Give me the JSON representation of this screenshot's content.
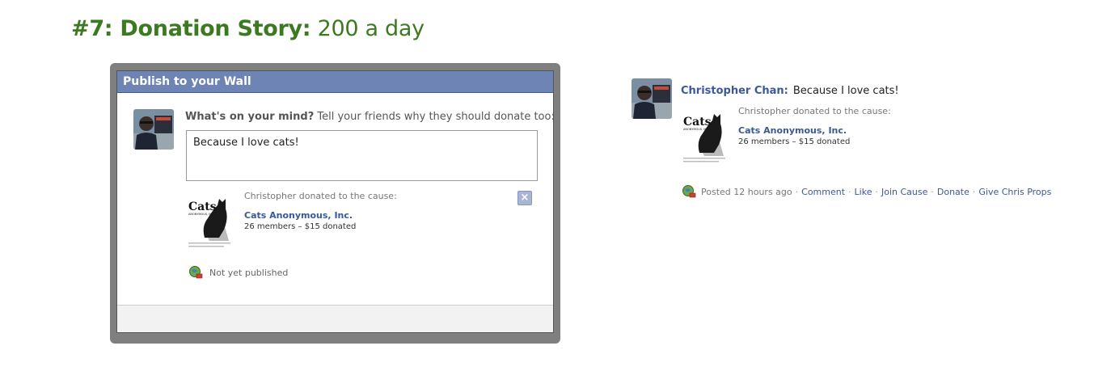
{
  "page": {
    "title_strong": "#7: Donation Story:",
    "title_rest": "200 a day"
  },
  "dialog": {
    "header": "Publish to your Wall",
    "prompt_bold": "What's on your mind?",
    "prompt_rest": "Tell your friends why they should donate too:",
    "message_value": "Because I love cats!",
    "close_label": "×",
    "status": "Not yet published"
  },
  "attachment": {
    "donated_line": "Christopher donated to the cause:",
    "cause_name": "Cats Anonymous, Inc.",
    "cause_stats": "26 members – $15 donated",
    "logo_text": "Cats",
    "logo_subtext": "ANONYMOUS, INC."
  },
  "feed": {
    "name": "Christopher Chan:",
    "message": "Because I love cats!",
    "donated_line": "Christopher donated to the cause:",
    "cause_name": "Cats Anonymous, Inc.",
    "cause_stats": "26 members – $15 donated",
    "posted": "Posted 12 hours ago",
    "actions": [
      "Comment",
      "Like",
      "Join Cause",
      "Donate",
      "Give Chris Props"
    ]
  },
  "colors": {
    "title_green": "#3c7a22",
    "fb_blue": "#3b5998",
    "header_blue": "#6d84b4"
  }
}
